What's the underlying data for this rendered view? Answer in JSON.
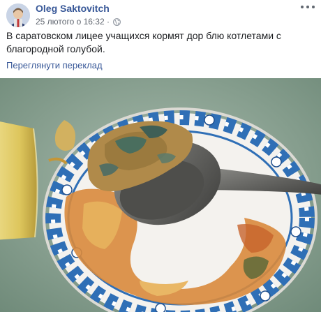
{
  "post": {
    "author": "Oleg Saktovitch",
    "timestamp": "25 лютого о 16:32",
    "privacy_icon": "globe-icon",
    "more_icon": "more-options-icon",
    "text": "В саратовском лицее учащихся кормят дор блю котлетами с благородной голубой.",
    "translate_link": "Переглянути переклад"
  },
  "photo": {
    "colors": {
      "table": "#8ea596",
      "plate": "#f4f2ee",
      "pattern": "#2f6fb6",
      "sauce": "#d98a3c",
      "spoon": "#6e6e6a",
      "cutlet": "#b08a4a",
      "mold": "#4a6e5e",
      "glass": "#e6cf67"
    }
  }
}
